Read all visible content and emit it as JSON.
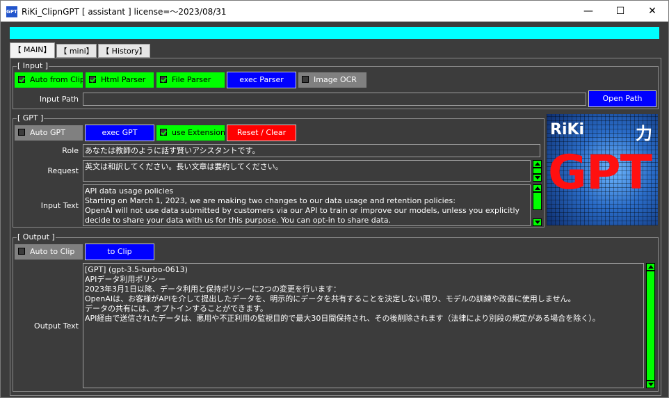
{
  "window": {
    "title": "RiKi_ClipnGPT [ assistant ] license=～2023/08/31",
    "icon_text": "GPT",
    "minimize_glyph": "—",
    "maximize_glyph": "☐",
    "close_glyph": "✕"
  },
  "tabs": [
    {
      "label": "【 MAIN】"
    },
    {
      "label": "【 mini】"
    },
    {
      "label": "【 History】"
    }
  ],
  "input_group": {
    "title": "[ Input ]",
    "auto_from_clip": {
      "label": "Auto from Clip",
      "checked": true
    },
    "html_parser": {
      "label": "Html Parser",
      "checked": true
    },
    "file_parser": {
      "label": "File Parser",
      "checked": true
    },
    "exec_parser": {
      "label": "exec Parser"
    },
    "image_ocr": {
      "label": "Image OCR",
      "checked": false
    },
    "input_path_label": "Input Path",
    "input_path_value": "",
    "open_path": {
      "label": "Open Path"
    }
  },
  "gpt_group": {
    "title": "[ GPT ]",
    "auto_gpt": {
      "label": "Auto GPT",
      "checked": false
    },
    "exec_gpt": {
      "label": "exec GPT"
    },
    "use_extensions": {
      "label": "use Extensions",
      "checked": true
    },
    "reset_clear": {
      "label": "Reset / Clear"
    },
    "role_label": "Role",
    "role_value": "あなたは教師のように話す賢いアシスタントです。",
    "request_label": "Request",
    "request_value": "英文は和訳してください。長い文章は要約してください。",
    "input_text_label": "Input Text",
    "input_text_value": "API data usage policies\nStarting on March 1, 2023, we are making two changes to our data usage and retention policies:\nOpenAI will not use data submitted by customers via our API to train or improve our models, unless you explicitly decide to share your data with us for this purpose. You can opt-in to share data."
  },
  "logo": {
    "brand": "RiKi",
    "kanji": "力",
    "product": "GPT"
  },
  "output_group": {
    "title": "[ Output ]",
    "auto_to_clip": {
      "label": "Auto to Clip",
      "checked": false
    },
    "to_clip": {
      "label": "to Clip"
    },
    "output_text_label": "Output Text",
    "output_text_value": "[GPT] (gpt-3.5-turbo-0613)\nAPIデータ利用ポリシー\n2023年3月1日以降、データ利用と保持ポリシーに2つの変更を行います：\nOpenAIは、お客様がAPIを介して提出したデータを、明示的にデータを共有することを決定しない限り、モデルの訓練や改善に使用しません。\nデータの共有には、オプトインすることができます。\nAPI経由で送信されたデータは、悪用や不正利用の監視目的で最大30日間保持され、その後削除されます（法律により別段の規定がある場合を除く）。"
  },
  "colors": {
    "background": "#3c3c3c",
    "accent_cyan": "#00ffff",
    "green": "#00ff00",
    "blue": "#0000ff",
    "red": "#ff0000",
    "gray": "#808080"
  }
}
